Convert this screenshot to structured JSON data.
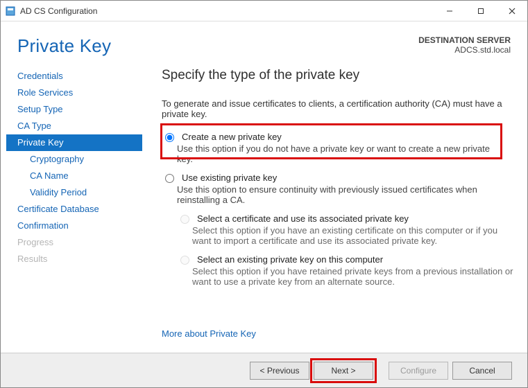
{
  "titlebar": {
    "title": "AD CS Configuration"
  },
  "header": {
    "page_title": "Private Key",
    "dest_label": "DESTINATION SERVER",
    "dest_value": "ADCS.std.local"
  },
  "sidebar": {
    "items": [
      {
        "label": "Credentials",
        "indent": false,
        "active": false,
        "disabled": false
      },
      {
        "label": "Role Services",
        "indent": false,
        "active": false,
        "disabled": false
      },
      {
        "label": "Setup Type",
        "indent": false,
        "active": false,
        "disabled": false
      },
      {
        "label": "CA Type",
        "indent": false,
        "active": false,
        "disabled": false
      },
      {
        "label": "Private Key",
        "indent": false,
        "active": true,
        "disabled": false
      },
      {
        "label": "Cryptography",
        "indent": true,
        "active": false,
        "disabled": false
      },
      {
        "label": "CA Name",
        "indent": true,
        "active": false,
        "disabled": false
      },
      {
        "label": "Validity Period",
        "indent": true,
        "active": false,
        "disabled": false
      },
      {
        "label": "Certificate Database",
        "indent": false,
        "active": false,
        "disabled": false
      },
      {
        "label": "Confirmation",
        "indent": false,
        "active": false,
        "disabled": false
      },
      {
        "label": "Progress",
        "indent": false,
        "active": false,
        "disabled": true
      },
      {
        "label": "Results",
        "indent": false,
        "active": false,
        "disabled": true
      }
    ]
  },
  "main": {
    "heading": "Specify the type of the private key",
    "intro": "To generate and issue certificates to clients, a certification authority (CA) must have a private key.",
    "opt_create": {
      "label": "Create a new private key",
      "desc": "Use this option if you do not have a private key or want to create a new private key."
    },
    "opt_existing": {
      "label": "Use existing private key",
      "desc": "Use this option to ensure continuity with previously issued certificates when reinstalling a CA.",
      "sub_cert": {
        "label": "Select a certificate and use its associated private key",
        "desc": "Select this option if you have an existing certificate on this computer or if you want to import a certificate and use its associated private key."
      },
      "sub_existing": {
        "label": "Select an existing private key on this computer",
        "desc": "Select this option if you have retained private keys from a previous installation or want to use a private key from an alternate source."
      }
    },
    "more_link": "More about Private Key"
  },
  "footer": {
    "previous": "< Previous",
    "next": "Next >",
    "configure": "Configure",
    "cancel": "Cancel"
  }
}
